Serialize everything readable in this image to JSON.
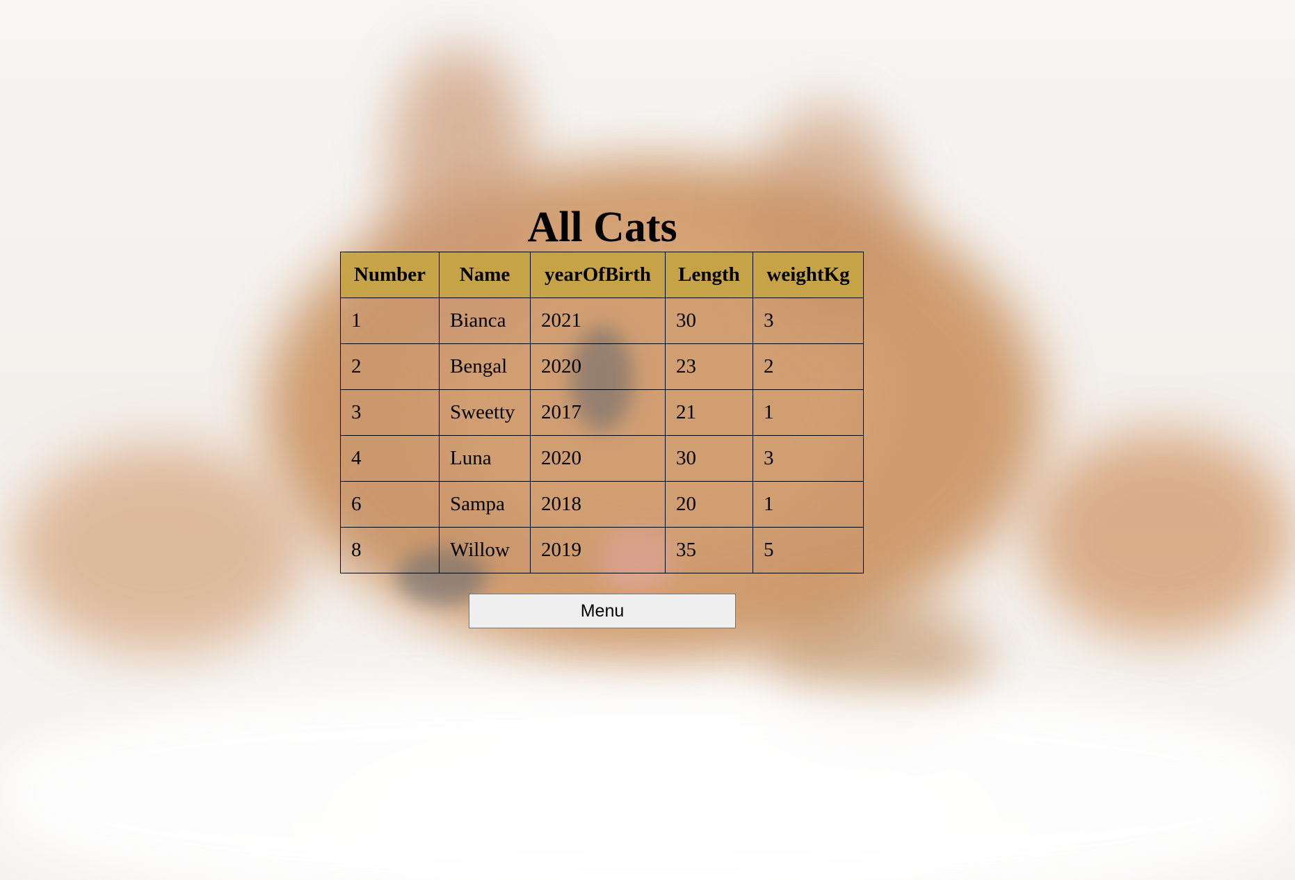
{
  "page": {
    "title": "All Cats"
  },
  "background": {
    "description_icon": "kitten-photo-background"
  },
  "table": {
    "headers": [
      "Number",
      "Name",
      "yearOfBirth",
      "Length",
      "weightKg"
    ],
    "header_color": "#c6a346",
    "rows": [
      [
        "1",
        "Bianca",
        "2021",
        "30",
        "3"
      ],
      [
        "2",
        "Bengal",
        "2020",
        "23",
        "2"
      ],
      [
        "3",
        "Sweetty",
        "2017",
        "21",
        "1"
      ],
      [
        "4",
        "Luna",
        "2020",
        "30",
        "3"
      ],
      [
        "6",
        "Sampa",
        "2018",
        "20",
        "1"
      ],
      [
        "8",
        "Willow",
        "2019",
        "35",
        "5"
      ]
    ]
  },
  "actions": {
    "menu_label": "Menu"
  }
}
